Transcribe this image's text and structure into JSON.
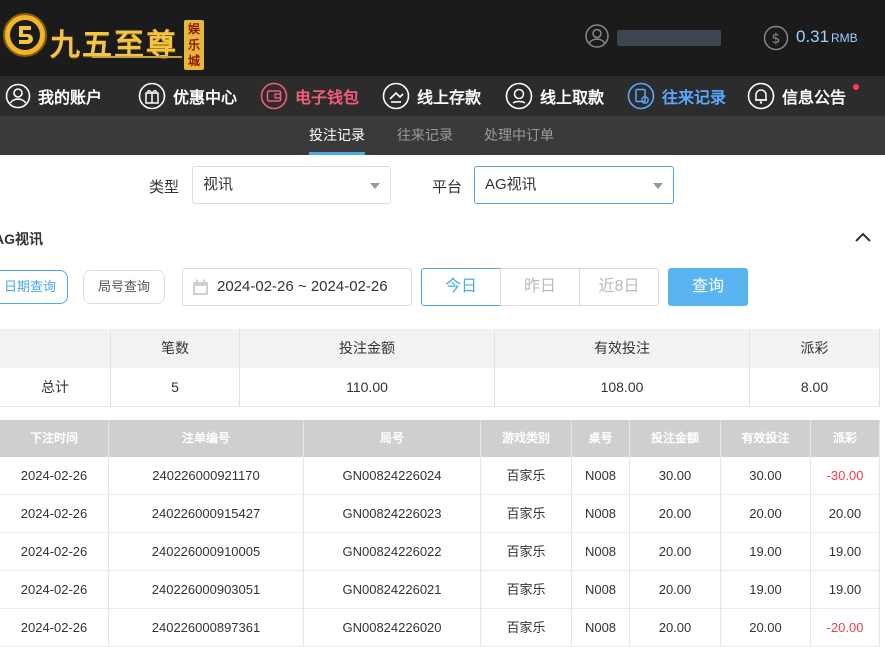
{
  "brand": {
    "name": "九五至尊",
    "badge": "娱乐城"
  },
  "user": {
    "balance": "0.31",
    "currency": "RMB"
  },
  "nav": [
    {
      "label": "我的账户",
      "icon": "user-circle-icon"
    },
    {
      "label": "优惠中心",
      "icon": "gift-icon"
    },
    {
      "label": "电子钱包",
      "icon": "wallet-icon"
    },
    {
      "label": "线上存款",
      "icon": "deposit-icon"
    },
    {
      "label": "线上取款",
      "icon": "withdraw-icon"
    },
    {
      "label": "往来记录",
      "icon": "record-icon"
    },
    {
      "label": "信息公告",
      "icon": "bell-icon"
    }
  ],
  "subtabs": [
    "投注记录",
    "往来记录",
    "处理中订单"
  ],
  "filters": {
    "type_label": "类型",
    "type_value": "视讯",
    "platform_label": "平台",
    "platform_value": "AG视讯"
  },
  "section_title": "AG视讯",
  "query": {
    "date_query": "日期查询",
    "round_query": "局号查询",
    "date_range": "2024-02-26 ~ 2024-02-26",
    "today": "今日",
    "yesterday": "昨日",
    "last8": "近8日",
    "submit": "查询"
  },
  "summary": {
    "headers": [
      "",
      "笔数",
      "投注金额",
      "有效投注",
      "派彩"
    ],
    "row": [
      "总计",
      "5",
      "110.00",
      "108.00",
      "8.00"
    ]
  },
  "detail": {
    "headers": [
      "下注时间",
      "注单编号",
      "局号",
      "游戏类别",
      "桌号",
      "投注金额",
      "有效投注",
      "派彩"
    ],
    "rows": [
      [
        "2024-02-26",
        "240226000921170",
        "GN00824226024",
        "百家乐",
        "N008",
        "30.00",
        "30.00",
        "-30.00"
      ],
      [
        "2024-02-26",
        "240226000915427",
        "GN00824226023",
        "百家乐",
        "N008",
        "20.00",
        "20.00",
        "20.00"
      ],
      [
        "2024-02-26",
        "240226000910005",
        "GN00824226022",
        "百家乐",
        "N008",
        "20.00",
        "19.00",
        "19.00"
      ],
      [
        "2024-02-26",
        "240226000903051",
        "GN00824226021",
        "百家乐",
        "N008",
        "20.00",
        "19.00",
        "19.00"
      ],
      [
        "2024-02-26",
        "240226000897361",
        "GN00824226020",
        "百家乐",
        "N008",
        "20.00",
        "20.00",
        "-20.00"
      ]
    ]
  },
  "colors": {
    "accent": "#4aa9e9",
    "negative": "#e8414a",
    "brand_gold": "#f5c542"
  }
}
